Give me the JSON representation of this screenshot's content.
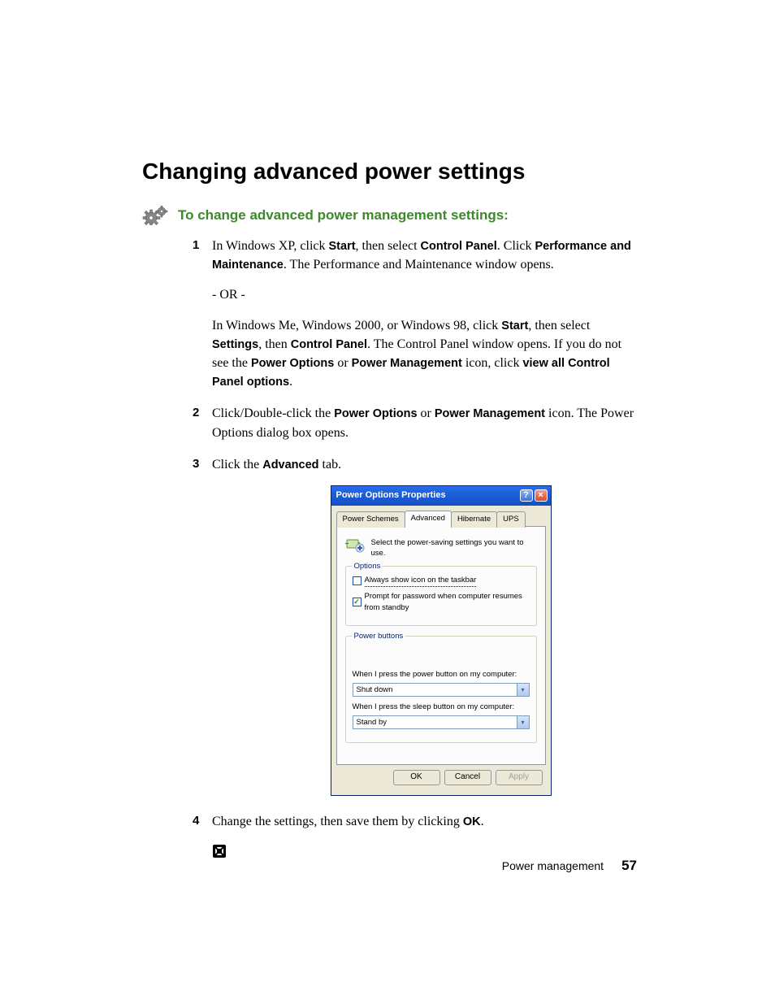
{
  "heading": "Changing advanced power settings",
  "subhead": "To change advanced power management settings:",
  "steps": {
    "s1": {
      "p1a": "In Windows XP, click ",
      "b1": "Start",
      "p1b": ", then select ",
      "b2": "Control Panel",
      "p1c": ". Click ",
      "b3": "Performance and Maintenance",
      "p1d": ". The Performance and Maintenance window opens.",
      "or": "- OR -",
      "p2a": "In Windows Me, Windows 2000, or Windows 98, click ",
      "b4": "Start",
      "p2b": ", then select ",
      "b5": "Settings",
      "p2c": ", then ",
      "b6": "Control Panel",
      "p2d": ". The Control Panel window opens. If you do not see the ",
      "b7": "Power Options",
      "p2e": " or ",
      "b8": "Power Management",
      "p2f": " icon, click ",
      "b9": "view all Control Panel options",
      "p2g": "."
    },
    "s2": {
      "a": "Click/Double-click the ",
      "b1": "Power Options",
      "mid": " or ",
      "b2": "Power Management",
      "end": " icon. The Power Options dialog box opens."
    },
    "s3": {
      "a": "Click the ",
      "b1": "Advanced",
      "end": " tab."
    },
    "s4": {
      "a": "Change the settings, then save them by clicking ",
      "b1": "OK",
      "end": "."
    }
  },
  "dialog": {
    "title": "Power Options Properties",
    "help_glyph": "?",
    "close_glyph": "×",
    "tabs": [
      "Power Schemes",
      "Advanced",
      "Hibernate",
      "UPS"
    ],
    "desc": "Select the power-saving settings you want to use.",
    "options_legend": "Options",
    "chk1": "Always show icon on the taskbar",
    "chk2": "Prompt for password when computer resumes from standby",
    "pb_legend": "Power buttons",
    "pb_label1": "When I press the power button on my computer:",
    "pb_value1": "Shut down",
    "pb_label2": "When I press the sleep button on my computer:",
    "pb_value2": "Stand by",
    "ok": "OK",
    "cancel": "Cancel",
    "apply": "Apply"
  },
  "footer": {
    "label": "Power management",
    "page": "57"
  }
}
